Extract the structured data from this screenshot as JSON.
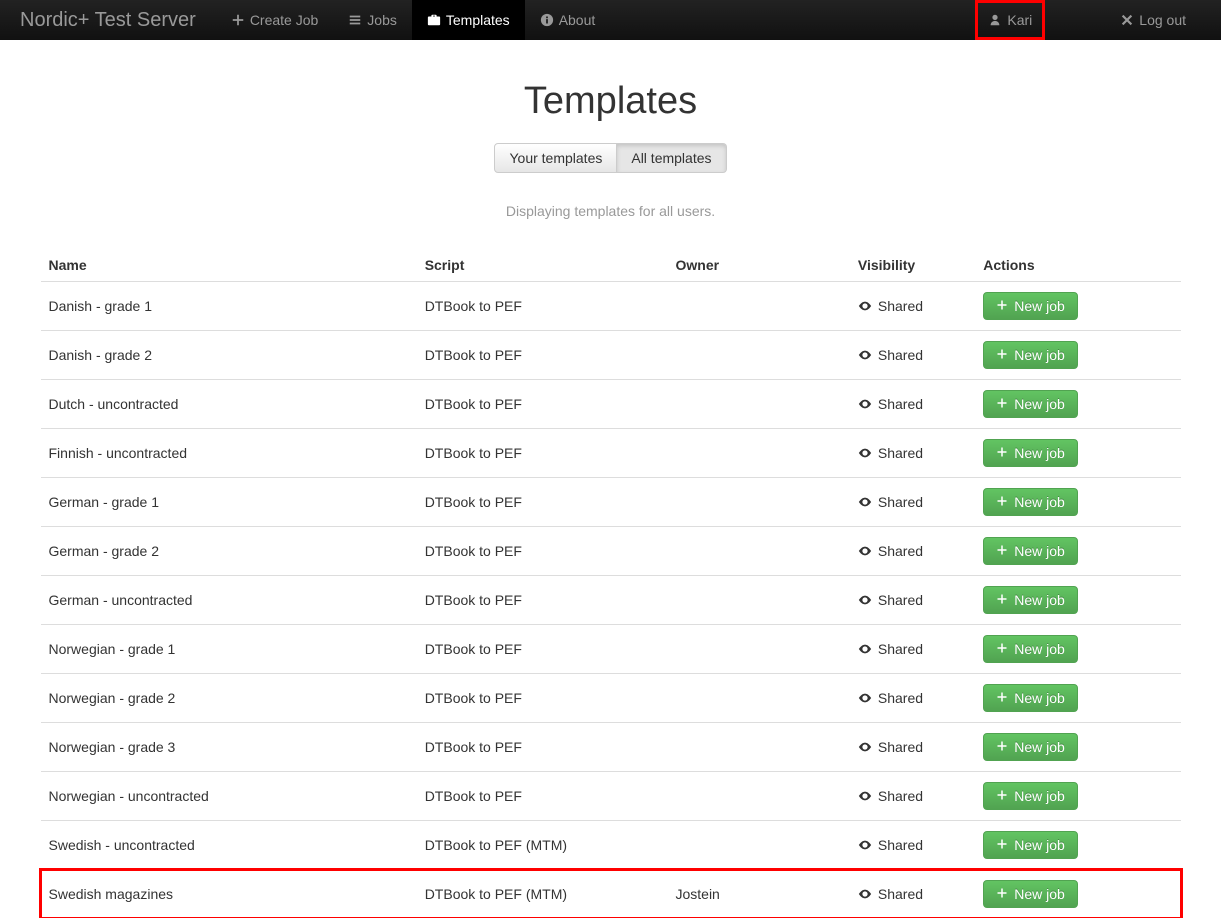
{
  "navbar": {
    "brand": "Nordic+ Test Server",
    "create_job": "Create Job",
    "jobs": "Jobs",
    "templates": "Templates",
    "about": "About",
    "user": "Kari",
    "logout": "Log out"
  },
  "page": {
    "title": "Templates",
    "tab_your": "Your templates",
    "tab_all": "All templates",
    "subtitle": "Displaying templates for all users."
  },
  "table": {
    "headers": {
      "name": "Name",
      "script": "Script",
      "owner": "Owner",
      "visibility": "Visibility",
      "actions": "Actions"
    },
    "new_job_label": "New job",
    "shared_label": "Shared",
    "rows": [
      {
        "name": "Danish - grade 1",
        "script": "DTBook to PEF",
        "owner": "",
        "visibility": "Shared",
        "highlight": false
      },
      {
        "name": "Danish - grade 2",
        "script": "DTBook to PEF",
        "owner": "",
        "visibility": "Shared",
        "highlight": false
      },
      {
        "name": "Dutch - uncontracted",
        "script": "DTBook to PEF",
        "owner": "",
        "visibility": "Shared",
        "highlight": false
      },
      {
        "name": "Finnish - uncontracted",
        "script": "DTBook to PEF",
        "owner": "",
        "visibility": "Shared",
        "highlight": false
      },
      {
        "name": "German - grade 1",
        "script": "DTBook to PEF",
        "owner": "",
        "visibility": "Shared",
        "highlight": false
      },
      {
        "name": "German - grade 2",
        "script": "DTBook to PEF",
        "owner": "",
        "visibility": "Shared",
        "highlight": false
      },
      {
        "name": "German - uncontracted",
        "script": "DTBook to PEF",
        "owner": "",
        "visibility": "Shared",
        "highlight": false
      },
      {
        "name": "Norwegian - grade 1",
        "script": "DTBook to PEF",
        "owner": "",
        "visibility": "Shared",
        "highlight": false
      },
      {
        "name": "Norwegian - grade 2",
        "script": "DTBook to PEF",
        "owner": "",
        "visibility": "Shared",
        "highlight": false
      },
      {
        "name": "Norwegian - grade 3",
        "script": "DTBook to PEF",
        "owner": "",
        "visibility": "Shared",
        "highlight": false
      },
      {
        "name": "Norwegian - uncontracted",
        "script": "DTBook to PEF",
        "owner": "",
        "visibility": "Shared",
        "highlight": false
      },
      {
        "name": "Swedish - uncontracted",
        "script": "DTBook to PEF (MTM)",
        "owner": "",
        "visibility": "Shared",
        "highlight": false
      },
      {
        "name": "Swedish magazines",
        "script": "DTBook to PEF (MTM)",
        "owner": "Jostein",
        "visibility": "Shared",
        "highlight": true
      }
    ]
  }
}
